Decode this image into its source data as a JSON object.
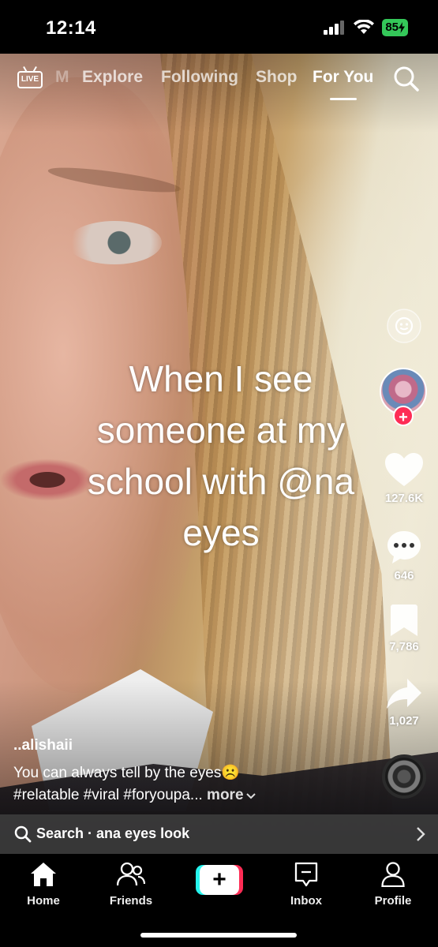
{
  "status_bar": {
    "time": "12:14",
    "battery": "85"
  },
  "top_nav": {
    "live_label": "LIVE",
    "tabs": [
      {
        "label": "M",
        "active": false
      },
      {
        "label": "Explore",
        "active": false
      },
      {
        "label": "Following",
        "active": false
      },
      {
        "label": "Shop",
        "active": false
      },
      {
        "label": "For You",
        "active": true
      }
    ]
  },
  "video": {
    "caption_lines": [
      "When I see",
      "someone at my",
      "school with @na",
      "eyes"
    ]
  },
  "actions": {
    "likes": "127.6K",
    "comments": "646",
    "saves": "7,786",
    "shares": "1,027"
  },
  "post": {
    "author": "..alishaii",
    "description_line1": "You can always tell by the eyes☹️",
    "description_line2": "#relatable #viral #foryoupa...",
    "more_label": "more"
  },
  "search_bar": {
    "label": "Search · ana eyes look"
  },
  "bottom_nav": {
    "items": [
      {
        "label": "Home",
        "icon": "home-icon"
      },
      {
        "label": "Friends",
        "icon": "friends-icon"
      },
      {
        "label": "Inbox",
        "icon": "inbox-icon"
      },
      {
        "label": "Profile",
        "icon": "profile-icon"
      }
    ]
  },
  "colors": {
    "accent_red": "#fe2c55",
    "accent_cyan": "#25f4ee",
    "battery_green": "#34c759"
  }
}
